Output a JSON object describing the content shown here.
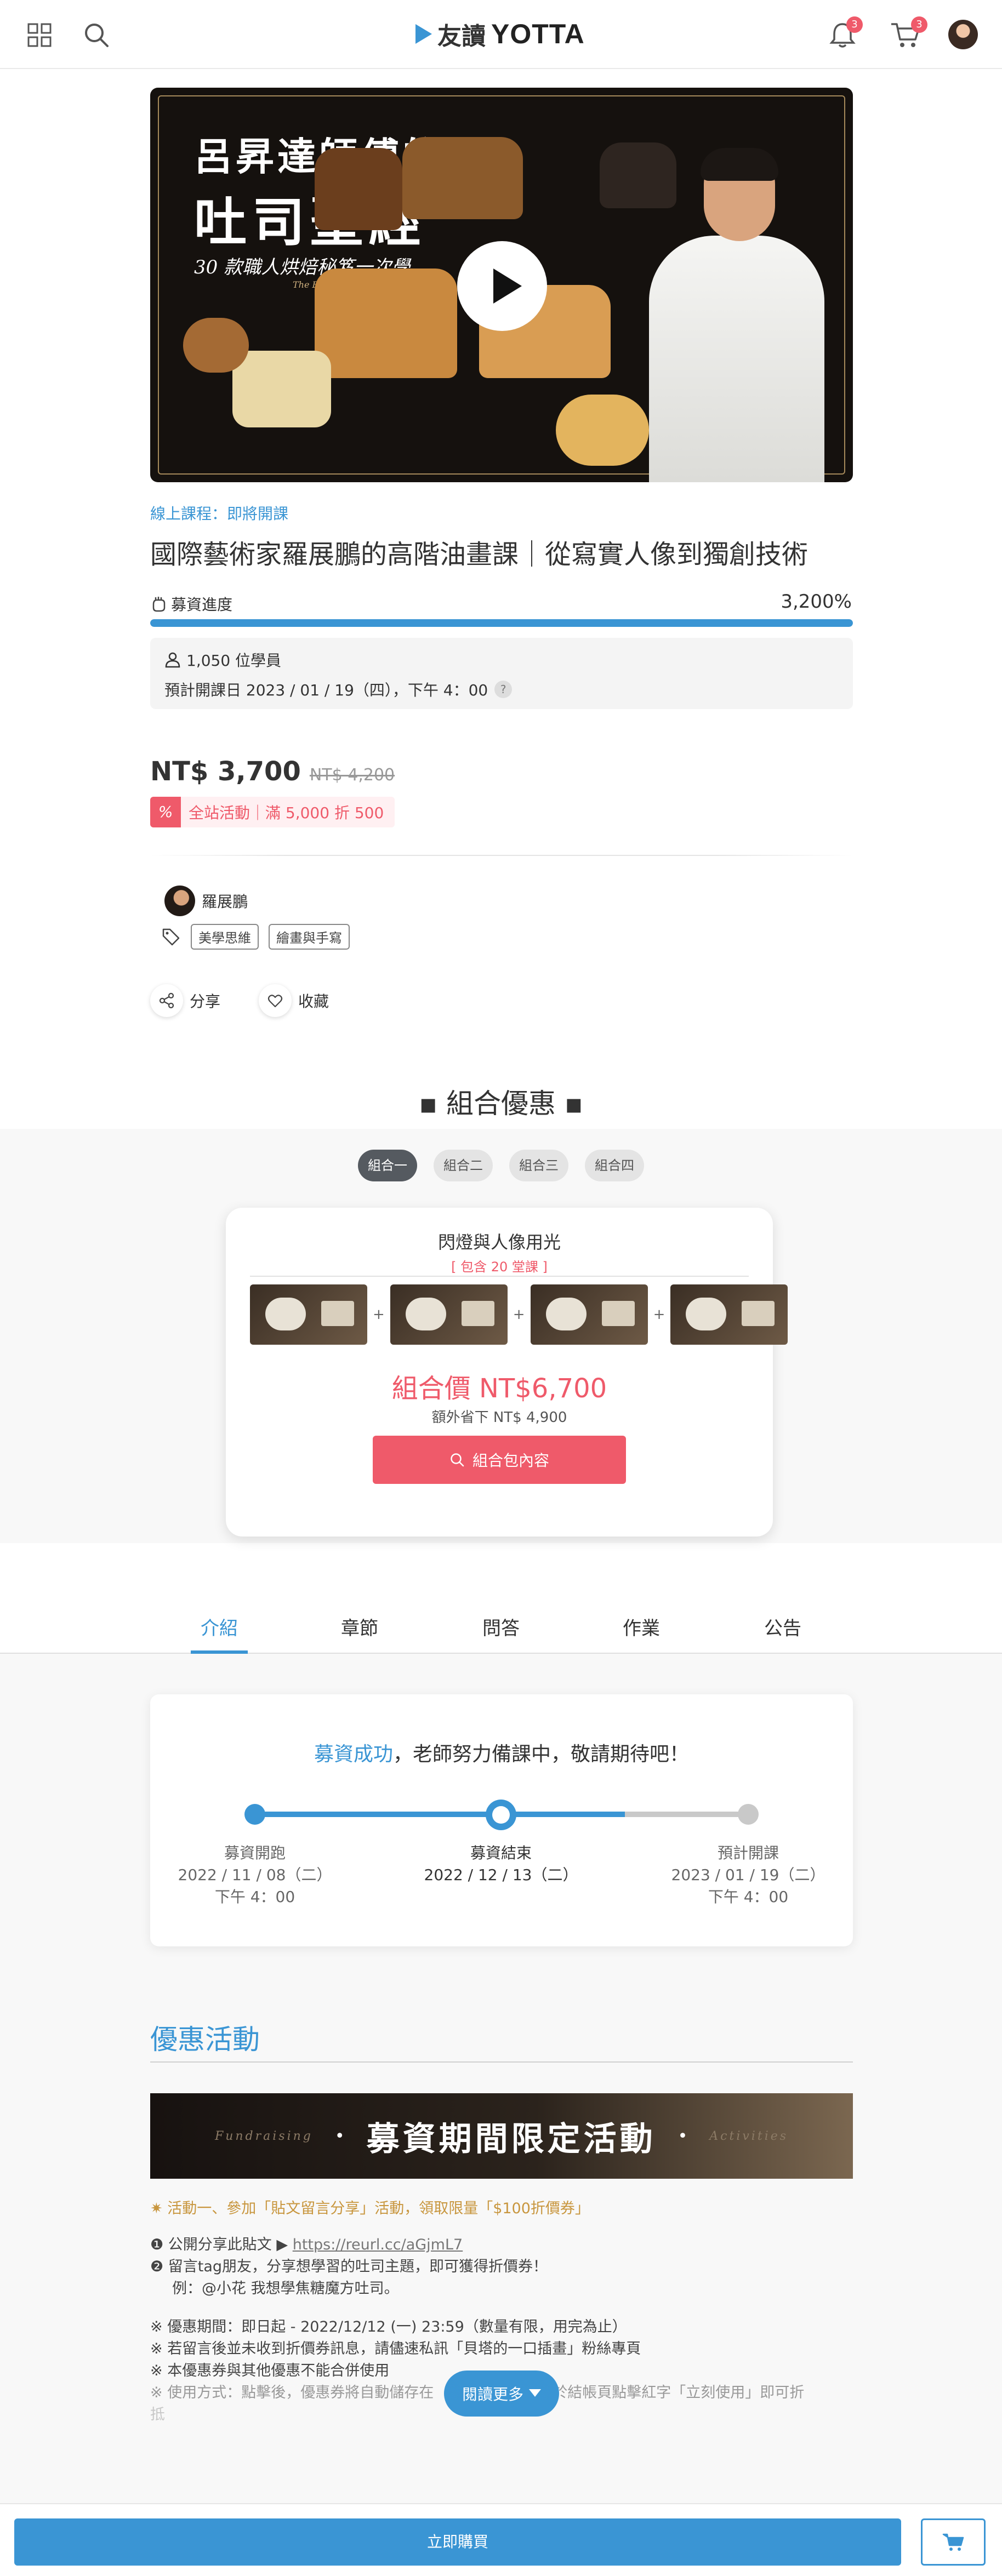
{
  "header": {
    "logo_zh": "友讀",
    "logo_en": "YOTTA",
    "notifications_count": "3",
    "cart_count": "3"
  },
  "hero": {
    "line1": "呂昇達師傅的",
    "line2": "吐司聖經",
    "line3": "30 款職人烘焙秘笈一次學",
    "line4": "The Baking Bible"
  },
  "course": {
    "status": "線上課程：即將開課",
    "title": "國際藝術家羅展鵬的高階油畫課｜從寫實人像到獨創技術",
    "progress_label": "募資進度",
    "progress_value": "3,200%",
    "progress_fraction": 1.0,
    "students": "1,050 位學員",
    "open_date": "預計開課日 2023 / 01 / 19（四），下午 4：00",
    "price": "NT$ 3,700",
    "original_price": "NT$ 4,200",
    "promo_icon": "%",
    "promo_text": "全站活動｜滿 5,000 折 500",
    "teacher": "羅展鵬",
    "tags": [
      "美學思維",
      "繪畫與手寫"
    ],
    "share": "分享",
    "favorite": "收藏"
  },
  "combo": {
    "heading": "▪ 組合優惠 ▪",
    "tabs": [
      "組合一",
      "組合二",
      "組合三",
      "組合四"
    ],
    "active_tab": 0,
    "name": "閃燈與人像用光",
    "includes": "[ 包含 20 堂課 ]",
    "price": "組合價 NT$6,700",
    "save": "額外省下 NT$ 4,900",
    "button": "組合包內容"
  },
  "tabs": [
    "介紹",
    "章節",
    "問答",
    "作業",
    "公告"
  ],
  "timeline": {
    "msg_highlight": "募資成功",
    "msg_rest": "，老師努力備課中，敬請期待吧！",
    "start_label": "募資開跑",
    "start_date": "2022 / 11 / 08（二）",
    "start_time": "下午 4：00",
    "end_label": "募資結束",
    "end_date": "2022 / 12 / 13（二）",
    "open_label": "預計開課",
    "open_date": "2023 / 01 / 19（二）",
    "open_time": "下午 4：00"
  },
  "offers": {
    "title": "優惠活動",
    "banner_left": "Fundraising",
    "banner_center": "募資期間限定活動",
    "banner_right": "Activities",
    "activity_heading": "✷ 活動一、參加「貼文留言分享」活動，領取限量「$100折價券」",
    "step1": "❶ 公開分享此貼文 ▶ ",
    "step1_link": "https://reurl.cc/aGjmL7",
    "step2": "❷ 留言tag朋友，分享想學習的吐司主題，即可獲得折價券！",
    "step2_example": "例：@小花 我想學焦糖魔方吐司。",
    "note1": "※ 優惠期間：即日起 - 2022/12/12 (一) 23:59（數量有限，用完為止）",
    "note2": "※ 若留言後並未收到折價券訊息，請儘速私訊「貝塔的一口插畫」粉絲專頁",
    "note3": "※ 本優惠券與其他優惠不能合併使用",
    "note4a": "※ 使用方式：點擊後，優惠券將自動儲存在",
    "note4b": "，於結帳頁點擊紅字「立刻使用」即可折",
    "note4c": "抵",
    "read_more": "閱讀更多"
  },
  "bottom": {
    "buy": "立即購買"
  },
  "colors": {
    "accent_blue": "#3a95d4",
    "accent_red": "#ef5a6a"
  }
}
